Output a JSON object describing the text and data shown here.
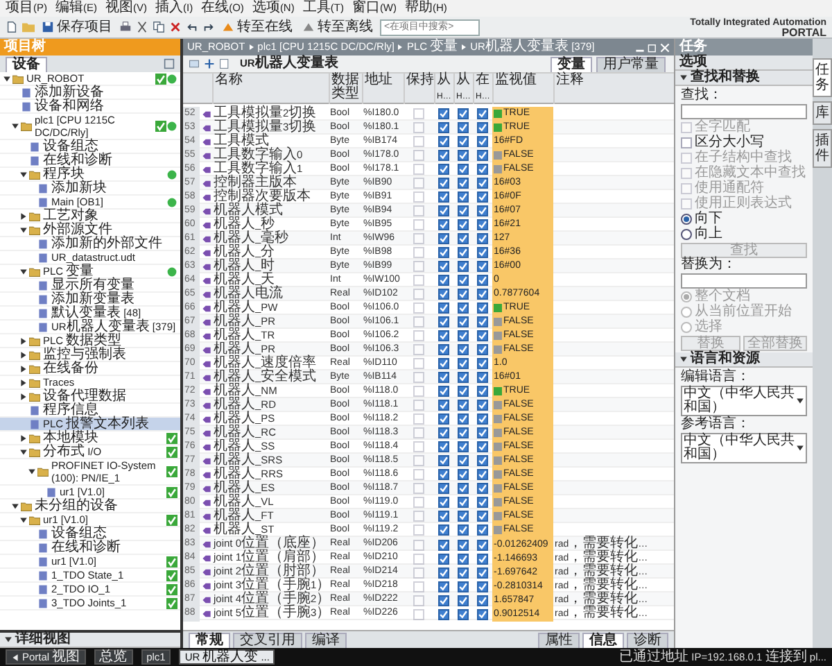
{
  "menu": [
    "项目(P)",
    "编辑(E)",
    "视图(V)",
    "插入(I)",
    "在线(O)",
    "选项(N)",
    "工具(T)",
    "窗口(W)",
    "帮助(H)"
  ],
  "toolbar": {
    "save": "保存项目",
    "go_online": "转至在线",
    "go_offline": "转至离线",
    "search_placeholder": "<在项目中搜索>"
  },
  "brand": {
    "line1": "Totally Integrated Automation",
    "line2": "PORTAL"
  },
  "project_tree": {
    "title": "项目树",
    "tab": "设备",
    "details_title": "详细视图",
    "nodes": [
      {
        "label": "UR_ROBOT",
        "expanded": true,
        "selected": false,
        "check": true,
        "dot": true,
        "children": [
          {
            "label": "添加新设备",
            "selected": false,
            "check": false,
            "dot": false
          },
          {
            "label": "设备和网络",
            "selected": false,
            "check": false,
            "dot": false
          },
          {
            "label": "plc1 [CPU 1215C DC/DC/Rly]",
            "expanded": true,
            "selected": false,
            "check": true,
            "dot": true,
            "children": [
              {
                "label": "设备组态",
                "selected": false,
                "check": false,
                "dot": false
              },
              {
                "label": "在线和诊断",
                "selected": false,
                "check": false,
                "dot": false
              },
              {
                "label": "程序块",
                "expanded": true,
                "selected": false,
                "check": false,
                "dot": true,
                "children": [
                  {
                    "label": "添加新块",
                    "selected": false,
                    "check": false,
                    "dot": false
                  },
                  {
                    "label": "Main [OB1]",
                    "selected": false,
                    "check": false,
                    "dot": true
                  }
                ]
              },
              {
                "label": "工艺对象",
                "expanded": false,
                "selected": false,
                "check": false,
                "dot": false
              },
              {
                "label": "外部源文件",
                "expanded": true,
                "selected": false,
                "check": false,
                "dot": false,
                "children": [
                  {
                    "label": "添加新的外部文件",
                    "selected": false,
                    "check": false,
                    "dot": false
                  },
                  {
                    "label": "UR_datastruct.udt",
                    "selected": false,
                    "check": false,
                    "dot": false
                  }
                ]
              },
              {
                "label": "PLC 变量",
                "expanded": true,
                "selected": false,
                "check": false,
                "dot": true,
                "children": [
                  {
                    "label": "显示所有变量",
                    "selected": false,
                    "check": false,
                    "dot": false
                  },
                  {
                    "label": "添加新变量表",
                    "selected": false,
                    "check": false,
                    "dot": false
                  },
                  {
                    "label": "默认变量表 [48]",
                    "selected": false,
                    "check": false,
                    "dot": false
                  },
                  {
                    "label": "UR机器人变量表 [379]",
                    "selected": false,
                    "check": false,
                    "dot": false
                  }
                ]
              },
              {
                "label": "PLC 数据类型",
                "expanded": false,
                "selected": false,
                "check": false,
                "dot": false
              },
              {
                "label": "监控与强制表",
                "expanded": false,
                "selected": false,
                "check": false,
                "dot": false
              },
              {
                "label": "在线备份",
                "expanded": false,
                "selected": false,
                "check": false,
                "dot": false
              },
              {
                "label": "Traces",
                "expanded": false,
                "selected": false,
                "check": false,
                "dot": false
              },
              {
                "label": "设备代理数据",
                "expanded": false,
                "selected": false,
                "check": false,
                "dot": false
              },
              {
                "label": "程序信息",
                "selected": false,
                "check": false,
                "dot": false
              },
              {
                "label": "PLC 报警文本列表",
                "selected": true,
                "check": false,
                "dot": false
              },
              {
                "label": "本地模块",
                "expanded": false,
                "selected": false,
                "check": true,
                "dot": false
              },
              {
                "label": "分布式 I/O",
                "expanded": true,
                "selected": false,
                "check": true,
                "dot": false,
                "children": [
                  {
                    "label": "PROFINET IO-System (100): PN/IE_1",
                    "expanded": true,
                    "selected": false,
                    "check": true,
                    "dot": false,
                    "children": [
                      {
                        "label": "ur1 [V1.0]",
                        "selected": false,
                        "check": true,
                        "dot": false
                      }
                    ]
                  }
                ]
              }
            ]
          },
          {
            "label": "未分组的设备",
            "expanded": true,
            "selected": false,
            "check": false,
            "dot": false,
            "children": [
              {
                "label": "ur1 [V1.0]",
                "expanded": true,
                "selected": false,
                "check": true,
                "dot": false,
                "children": [
                  {
                    "label": "设备组态",
                    "selected": false,
                    "check": false,
                    "dot": false
                  },
                  {
                    "label": "在线和诊断",
                    "selected": false,
                    "check": false,
                    "dot": false
                  },
                  {
                    "label": "ur1 [V1.0]",
                    "selected": false,
                    "check": true,
                    "dot": false
                  },
                  {
                    "label": "1_TDO State_1",
                    "selected": false,
                    "check": true,
                    "dot": false
                  },
                  {
                    "label": "2_TDO IO_1",
                    "selected": false,
                    "check": true,
                    "dot": false
                  },
                  {
                    "label": "3_TDO Joints_1",
                    "selected": false,
                    "check": true,
                    "dot": false
                  }
                ]
              }
            ]
          }
        ]
      }
    ]
  },
  "editor": {
    "breadcrumb": [
      "UR_ROBOT",
      "plc1 [CPU 1215C DC/DC/Rly]",
      "PLC 变量",
      "UR机器人变量表 [379]"
    ],
    "tabs": [
      {
        "label": "变量",
        "selected": true
      },
      {
        "label": "用户常量",
        "selected": false
      }
    ],
    "table_title": "UR机器人变量表",
    "columns": [
      "名称",
      "数据类型",
      "地址",
      "保持",
      "从 H…",
      "从 H…",
      "在 H…",
      "监视值",
      "注释"
    ],
    "rows": [
      {
        "num": "52",
        "name": "工具模拟量2切换",
        "type": "Bool",
        "address": "%I180.0",
        "retain": false,
        "hmi_access": true,
        "hmi_write": true,
        "hmi_visible": true,
        "monitor": "TRUE",
        "kind": "bool",
        "on": true
      },
      {
        "num": "53",
        "name": "工具模拟量3切换",
        "type": "Bool",
        "address": "%I180.1",
        "retain": false,
        "hmi_access": true,
        "hmi_write": true,
        "hmi_visible": true,
        "monitor": "TRUE",
        "kind": "bool",
        "on": true
      },
      {
        "num": "54",
        "name": "工具模式",
        "type": "Byte",
        "address": "%IB174",
        "retain": false,
        "hmi_access": true,
        "hmi_write": true,
        "hmi_visible": true,
        "monitor": "16#FD",
        "kind": "value"
      },
      {
        "num": "55",
        "name": "工具数字输入0",
        "type": "Bool",
        "address": "%I178.0",
        "retain": false,
        "hmi_access": true,
        "hmi_write": true,
        "hmi_visible": true,
        "monitor": "FALSE",
        "kind": "bool",
        "on": false
      },
      {
        "num": "56",
        "name": "工具数字输入1",
        "type": "Bool",
        "address": "%I178.1",
        "retain": false,
        "hmi_access": true,
        "hmi_write": true,
        "hmi_visible": true,
        "monitor": "FALSE",
        "kind": "bool",
        "on": false
      },
      {
        "num": "57",
        "name": "控制器主版本",
        "type": "Byte",
        "address": "%IB90",
        "retain": false,
        "hmi_access": true,
        "hmi_write": true,
        "hmi_visible": true,
        "monitor": "16#03",
        "kind": "value"
      },
      {
        "num": "58",
        "name": "控制器次要版本",
        "type": "Byte",
        "address": "%IB91",
        "retain": false,
        "hmi_access": true,
        "hmi_write": true,
        "hmi_visible": true,
        "monitor": "16#0F",
        "kind": "value"
      },
      {
        "num": "59",
        "name": "机器人模式",
        "type": "Byte",
        "address": "%IB94",
        "retain": false,
        "hmi_access": true,
        "hmi_write": true,
        "hmi_visible": true,
        "monitor": "16#07",
        "kind": "value"
      },
      {
        "num": "60",
        "name": "机器人_秒",
        "type": "Byte",
        "address": "%IB95",
        "retain": false,
        "hmi_access": true,
        "hmi_write": true,
        "hmi_visible": true,
        "monitor": "16#21",
        "kind": "value"
      },
      {
        "num": "61",
        "name": "机器人_毫秒",
        "type": "Int",
        "address": "%IW96",
        "retain": false,
        "hmi_access": true,
        "hmi_write": true,
        "hmi_visible": true,
        "monitor": "127",
        "kind": "value"
      },
      {
        "num": "62",
        "name": "机器人_分",
        "type": "Byte",
        "address": "%IB98",
        "retain": false,
        "hmi_access": true,
        "hmi_write": true,
        "hmi_visible": true,
        "monitor": "16#36",
        "kind": "value"
      },
      {
        "num": "63",
        "name": "机器人_时",
        "type": "Byte",
        "address": "%IB99",
        "retain": false,
        "hmi_access": true,
        "hmi_write": true,
        "hmi_visible": true,
        "monitor": "16#00",
        "kind": "value"
      },
      {
        "num": "64",
        "name": "机器人_天",
        "type": "Int",
        "address": "%IW100",
        "retain": false,
        "hmi_access": true,
        "hmi_write": true,
        "hmi_visible": true,
        "monitor": "0",
        "kind": "value"
      },
      {
        "num": "65",
        "name": "机器人电流",
        "type": "Real",
        "address": "%ID102",
        "retain": false,
        "hmi_access": true,
        "hmi_write": true,
        "hmi_visible": true,
        "monitor": "0.7877604",
        "kind": "value"
      },
      {
        "num": "66",
        "name": "机器人_PW",
        "type": "Bool",
        "address": "%I106.0",
        "retain": false,
        "hmi_access": true,
        "hmi_write": true,
        "hmi_visible": true,
        "monitor": "TRUE",
        "kind": "bool",
        "on": true
      },
      {
        "num": "67",
        "name": "机器人_PR",
        "type": "Bool",
        "address": "%I106.1",
        "retain": false,
        "hmi_access": true,
        "hmi_write": true,
        "hmi_visible": true,
        "monitor": "FALSE",
        "kind": "bool",
        "on": false
      },
      {
        "num": "68",
        "name": "机器人_TR",
        "type": "Bool",
        "address": "%I106.2",
        "retain": false,
        "hmi_access": true,
        "hmi_write": true,
        "hmi_visible": true,
        "monitor": "FALSE",
        "kind": "bool",
        "on": false
      },
      {
        "num": "69",
        "name": "机器人_PR",
        "type": "Bool",
        "address": "%I106.3",
        "retain": false,
        "hmi_access": true,
        "hmi_write": true,
        "hmi_visible": true,
        "monitor": "FALSE",
        "kind": "bool",
        "on": false
      },
      {
        "num": "70",
        "name": "机器人_速度倍率",
        "type": "Real",
        "address": "%ID110",
        "retain": false,
        "hmi_access": true,
        "hmi_write": true,
        "hmi_visible": true,
        "monitor": "1.0",
        "kind": "value"
      },
      {
        "num": "71",
        "name": "机器人_安全模式",
        "type": "Byte",
        "address": "%IB114",
        "retain": false,
        "hmi_access": true,
        "hmi_write": true,
        "hmi_visible": true,
        "monitor": "16#01",
        "kind": "value"
      },
      {
        "num": "72",
        "name": "机器人_NM",
        "type": "Bool",
        "address": "%I118.0",
        "retain": false,
        "hmi_access": true,
        "hmi_write": true,
        "hmi_visible": true,
        "monitor": "TRUE",
        "kind": "bool",
        "on": true
      },
      {
        "num": "73",
        "name": "机器人_RD",
        "type": "Bool",
        "address": "%I118.1",
        "retain": false,
        "hmi_access": true,
        "hmi_write": true,
        "hmi_visible": true,
        "monitor": "FALSE",
        "kind": "bool",
        "on": false
      },
      {
        "num": "74",
        "name": "机器人_PS",
        "type": "Bool",
        "address": "%I118.2",
        "retain": false,
        "hmi_access": true,
        "hmi_write": true,
        "hmi_visible": true,
        "monitor": "FALSE",
        "kind": "bool",
        "on": false
      },
      {
        "num": "75",
        "name": "机器人_RC",
        "type": "Bool",
        "address": "%I118.3",
        "retain": false,
        "hmi_access": true,
        "hmi_write": true,
        "hmi_visible": true,
        "monitor": "FALSE",
        "kind": "bool",
        "on": false
      },
      {
        "num": "76",
        "name": "机器人_SS",
        "type": "Bool",
        "address": "%I118.4",
        "retain": false,
        "hmi_access": true,
        "hmi_write": true,
        "hmi_visible": true,
        "monitor": "FALSE",
        "kind": "bool",
        "on": false
      },
      {
        "num": "77",
        "name": "机器人_SRS",
        "type": "Bool",
        "address": "%I118.5",
        "retain": false,
        "hmi_access": true,
        "hmi_write": true,
        "hmi_visible": true,
        "monitor": "FALSE",
        "kind": "bool",
        "on": false
      },
      {
        "num": "78",
        "name": "机器人_RRS",
        "type": "Bool",
        "address": "%I118.6",
        "retain": false,
        "hmi_access": true,
        "hmi_write": true,
        "hmi_visible": true,
        "monitor": "FALSE",
        "kind": "bool",
        "on": false
      },
      {
        "num": "79",
        "name": "机器人_ES",
        "type": "Bool",
        "address": "%I118.7",
        "retain": false,
        "hmi_access": true,
        "hmi_write": true,
        "hmi_visible": true,
        "monitor": "FALSE",
        "kind": "bool",
        "on": false
      },
      {
        "num": "80",
        "name": "机器人_VL",
        "type": "Bool",
        "address": "%I119.0",
        "retain": false,
        "hmi_access": true,
        "hmi_write": true,
        "hmi_visible": true,
        "monitor": "FALSE",
        "kind": "bool",
        "on": false
      },
      {
        "num": "81",
        "name": "机器人_FT",
        "type": "Bool",
        "address": "%I119.1",
        "retain": false,
        "hmi_access": true,
        "hmi_write": true,
        "hmi_visible": true,
        "monitor": "FALSE",
        "kind": "bool",
        "on": false
      },
      {
        "num": "82",
        "name": "机器人_ST",
        "type": "Bool",
        "address": "%I119.2",
        "retain": false,
        "hmi_access": true,
        "hmi_write": true,
        "hmi_visible": true,
        "monitor": "FALSE",
        "kind": "bool",
        "on": false
      },
      {
        "num": "83",
        "name": "joint 0位置（底座）",
        "type": "Real",
        "address": "%ID206",
        "retain": false,
        "hmi_access": true,
        "hmi_write": true,
        "hmi_visible": true,
        "monitor": "-0.01262409",
        "kind": "value",
        "comment": "rad，需要转化…"
      },
      {
        "num": "84",
        "name": "joint 1位置（肩部）",
        "type": "Real",
        "address": "%ID210",
        "retain": false,
        "hmi_access": true,
        "hmi_write": true,
        "hmi_visible": true,
        "monitor": "-1.146693",
        "kind": "value",
        "comment": "rad，需要转化…"
      },
      {
        "num": "85",
        "name": "joint 2位置（肘部）",
        "type": "Real",
        "address": "%ID214",
        "retain": false,
        "hmi_access": true,
        "hmi_write": true,
        "hmi_visible": true,
        "monitor": "-1.697642",
        "kind": "value",
        "comment": "rad，需要转化…"
      },
      {
        "num": "86",
        "name": "joint 3位置（手腕1）",
        "type": "Real",
        "address": "%ID218",
        "retain": false,
        "hmi_access": true,
        "hmi_write": true,
        "hmi_visible": true,
        "monitor": "-0.2810314",
        "kind": "value",
        "comment": "rad，需要转化…"
      },
      {
        "num": "87",
        "name": "joint 4位置（手腕2）",
        "type": "Real",
        "address": "%ID222",
        "retain": false,
        "hmi_access": true,
        "hmi_write": true,
        "hmi_visible": true,
        "monitor": "1.657847",
        "kind": "value",
        "comment": "rad，需要转化…"
      },
      {
        "num": "88",
        "name": "joint 5位置（手腕3）",
        "type": "Real",
        "address": "%ID226",
        "retain": false,
        "hmi_access": true,
        "hmi_write": true,
        "hmi_visible": true,
        "monitor": "0.9012514",
        "kind": "value",
        "comment": "rad，需要转化…"
      }
    ],
    "bottom_tabs": [
      {
        "label": "常规",
        "selected": true
      },
      {
        "label": "交叉引用",
        "selected": false
      },
      {
        "label": "编译",
        "selected": false
      }
    ],
    "inspector_tabs": [
      {
        "label": "属性",
        "selected": false
      },
      {
        "label": "信息",
        "selected": true
      },
      {
        "label": "诊断",
        "selected": false
      }
    ]
  },
  "task_panel": {
    "title": "任务",
    "subtitle": "选项",
    "find_section": "查找和替换",
    "find_label": "查找：",
    "options": [
      {
        "label": "全字匹配",
        "checked": false,
        "disabled": true
      },
      {
        "label": "区分大小写",
        "checked": false,
        "disabled": false
      },
      {
        "label": "在子结构中查找",
        "checked": false,
        "disabled": true
      },
      {
        "label": "在隐藏文本中查找",
        "checked": false,
        "disabled": true
      },
      {
        "label": "使用通配符",
        "checked": false,
        "disabled": true
      },
      {
        "label": "使用正则表达式",
        "checked": false,
        "disabled": true
      }
    ],
    "directions": [
      {
        "label": "向下",
        "selected": true,
        "disabled": false
      },
      {
        "label": "向上",
        "selected": false,
        "disabled": false
      }
    ],
    "find_button": {
      "label": "查找",
      "disabled": true
    },
    "replace_label": "替换为：",
    "scopes": [
      {
        "label": "整个文档",
        "selected": true,
        "disabled": true
      },
      {
        "label": "从当前位置开始",
        "selected": false,
        "disabled": true
      },
      {
        "label": "选择",
        "selected": false,
        "disabled": true
      }
    ],
    "replace_buttons": [
      {
        "label": "替换",
        "disabled": true
      },
      {
        "label": "全部替换",
        "disabled": true
      }
    ],
    "language_section": "语言和资源",
    "edit_language_label": "编辑语言：",
    "edit_language": "中文（中华人民共和国）",
    "reference_language_label": "参考语言：",
    "reference_language": "中文（中华人民共和国）"
  },
  "side_tabs": [
    {
      "label": "任务",
      "selected": true
    },
    {
      "label": "库",
      "selected": false
    },
    {
      "label": "插件",
      "selected": false
    }
  ],
  "taskbar": {
    "portal": "Portal 视图",
    "items": [
      {
        "label": "总览",
        "selected": false
      },
      {
        "label": "plc1",
        "selected": false
      },
      {
        "label": "UR机器人变...",
        "selected": true
      }
    ],
    "status": "已通过地址 IP=192.168.0.1 连接到 pl..."
  }
}
